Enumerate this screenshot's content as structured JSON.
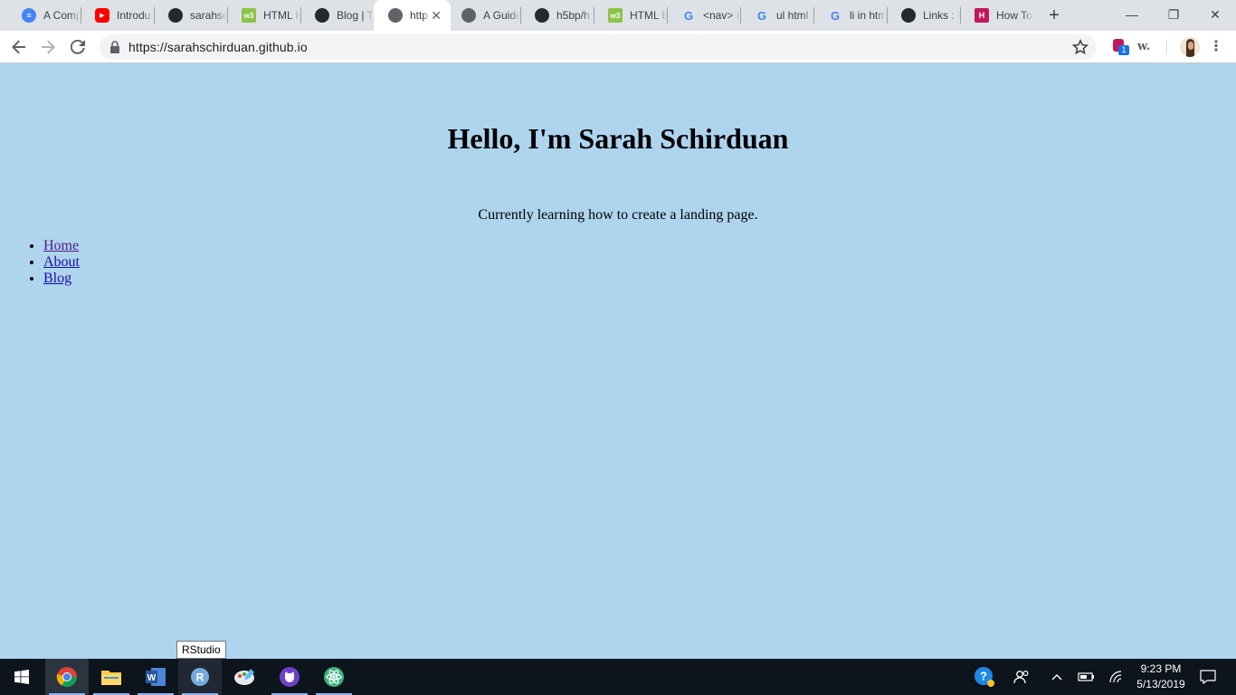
{
  "browser": {
    "tabs": [
      {
        "label": "A Comp",
        "icon": "google-docs-icon",
        "color": "#4285f4"
      },
      {
        "label": "Introdu",
        "icon": "youtube-icon",
        "color": "#ff0000"
      },
      {
        "label": "sarahsc",
        "icon": "github-icon",
        "color": "#24292e"
      },
      {
        "label": "HTML H",
        "icon": "w3schools-icon",
        "color": "#8bc34a"
      },
      {
        "label": "Blog | T",
        "icon": "gear-logo-icon",
        "color": "#24292e"
      },
      {
        "label": "http",
        "icon": "globe-icon",
        "color": "#5f6368",
        "active": true
      },
      {
        "label": "A Guide",
        "icon": "globe-icon",
        "color": "#5f6368"
      },
      {
        "label": "h5bp/h",
        "icon": "github-icon",
        "color": "#24292e"
      },
      {
        "label": "HTML b",
        "icon": "w3schools-icon",
        "color": "#8bc34a"
      },
      {
        "label": "<nav> I",
        "icon": "google-icon",
        "color": "#4285f4"
      },
      {
        "label": "ul html",
        "icon": "google-icon",
        "color": "#4285f4"
      },
      {
        "label": "li in htm",
        "icon": "google-icon",
        "color": "#4285f4"
      },
      {
        "label": "Links : H",
        "icon": "diamond-logo-icon",
        "color": "#24292e"
      },
      {
        "label": "How To",
        "icon": "hackernoon-icon",
        "color": "#c2185b"
      }
    ],
    "new_tab_glyph": "+",
    "window_controls": {
      "minimize": "—",
      "restore": "❐",
      "close": "✕"
    },
    "url": "https://sarahschirduan.github.io",
    "extension_badge": "1",
    "extension_w_label": "w."
  },
  "page": {
    "heading": "Hello, I'm Sarah Schirduan",
    "lead": "Currently learning how to create a landing page.",
    "nav": [
      {
        "label": "Home"
      },
      {
        "label": "About"
      },
      {
        "label": "Blog"
      }
    ],
    "background": "#aed4ee"
  },
  "taskbar": {
    "tooltip": "RStudio",
    "apps": [
      {
        "name": "chrome-icon"
      },
      {
        "name": "file-explorer-icon"
      },
      {
        "name": "word-icon"
      },
      {
        "name": "rstudio-icon"
      },
      {
        "name": "paint-icon"
      },
      {
        "name": "github-desktop-icon"
      },
      {
        "name": "atom-icon"
      }
    ],
    "time": "9:23 PM",
    "date": "5/13/2019"
  }
}
